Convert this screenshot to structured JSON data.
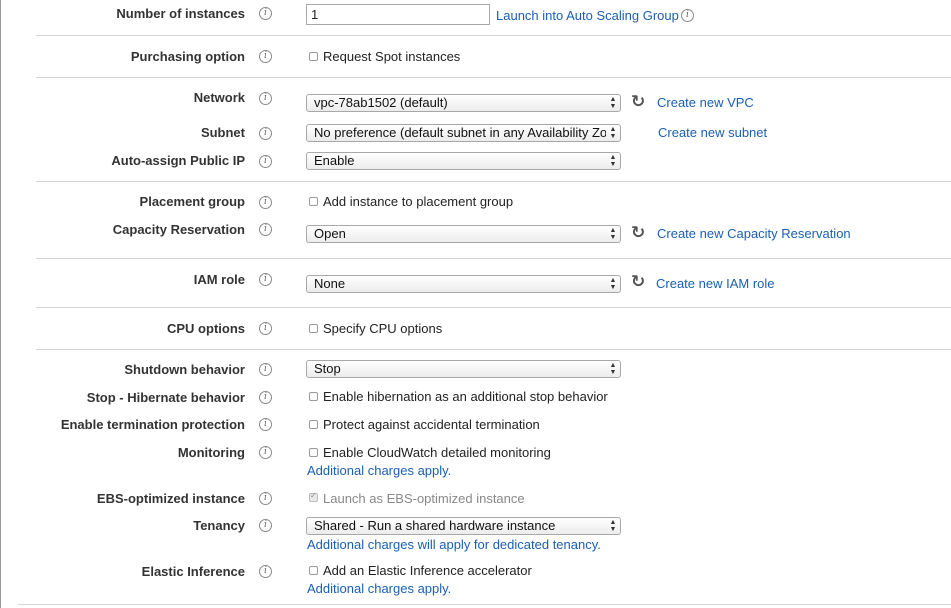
{
  "rows": {
    "num_instances": {
      "label": "Number of instances",
      "value": "1",
      "link": "Launch into Auto Scaling Group"
    },
    "purchasing": {
      "label": "Purchasing option",
      "checkbox": "Request Spot instances"
    },
    "network": {
      "label": "Network",
      "selected": "vpc-78ab1502 (default)",
      "link": "Create new VPC"
    },
    "subnet": {
      "label": "Subnet",
      "selected": "No preference (default subnet in any Availability Zon",
      "link": "Create new subnet"
    },
    "public_ip": {
      "label": "Auto-assign Public IP",
      "selected": "Enable"
    },
    "placement": {
      "label": "Placement group",
      "checkbox": "Add instance to placement group"
    },
    "capacity": {
      "label": "Capacity Reservation",
      "selected": "Open",
      "link": "Create new Capacity Reservation"
    },
    "iam": {
      "label": "IAM role",
      "selected": "None",
      "link": "Create new IAM role"
    },
    "cpu": {
      "label": "CPU options",
      "checkbox": "Specify CPU options"
    },
    "shutdown": {
      "label": "Shutdown behavior",
      "selected": "Stop"
    },
    "hibernate": {
      "label": "Stop - Hibernate behavior",
      "checkbox": "Enable hibernation as an additional stop behavior"
    },
    "termination": {
      "label": "Enable termination protection",
      "checkbox": "Protect against accidental termination"
    },
    "monitoring": {
      "label": "Monitoring",
      "checkbox": "Enable CloudWatch detailed monitoring",
      "note": "Additional charges apply."
    },
    "ebs": {
      "label": "EBS-optimized instance",
      "checkbox": "Launch as EBS-optimized instance",
      "checked": true
    },
    "tenancy": {
      "label": "Tenancy",
      "selected": "Shared - Run a shared hardware instance",
      "note": "Additional charges will apply for dedicated tenancy."
    },
    "inference": {
      "label": "Elastic Inference",
      "checkbox": "Add an Elastic Inference accelerator",
      "note": "Additional charges apply."
    }
  },
  "icons": {
    "info": "i",
    "refresh": "↻"
  },
  "colors": {
    "link": "#1a5fb4",
    "label": "#333333",
    "divider": "#d5d5d5"
  }
}
